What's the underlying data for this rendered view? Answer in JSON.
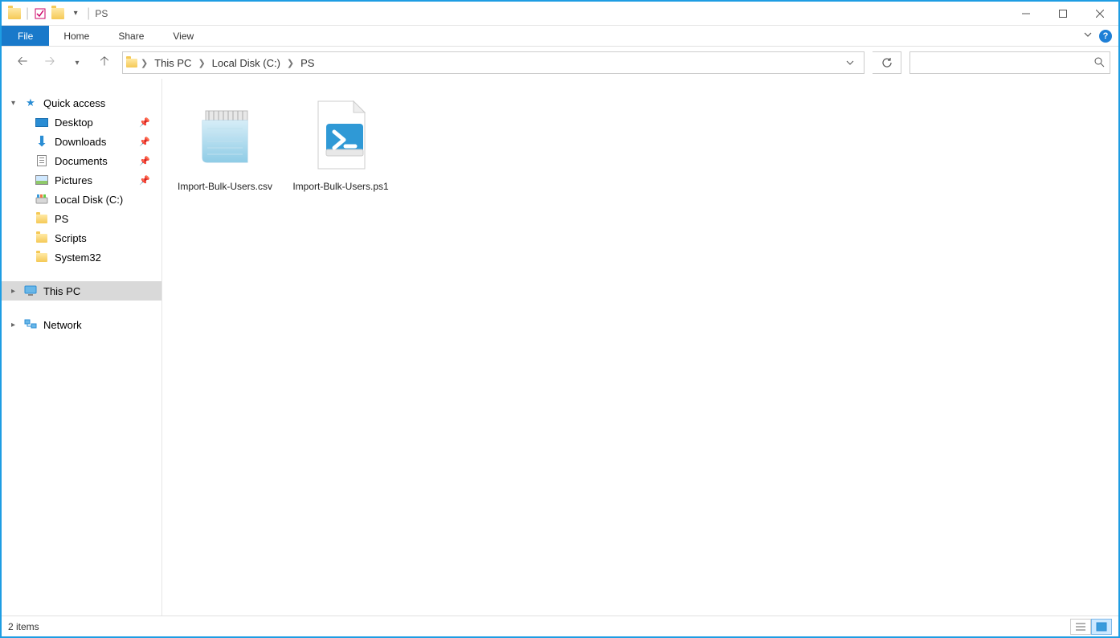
{
  "window": {
    "title": "PS"
  },
  "ribbon": {
    "file": "File",
    "tabs": [
      "Home",
      "Share",
      "View"
    ]
  },
  "breadcrumbs": [
    "This PC",
    "Local Disk (C:)",
    "PS"
  ],
  "sidebar": {
    "quick_access": {
      "label": "Quick access",
      "items": [
        {
          "label": "Desktop",
          "pinned": true,
          "icon": "desktop"
        },
        {
          "label": "Downloads",
          "pinned": true,
          "icon": "downloads"
        },
        {
          "label": "Documents",
          "pinned": true,
          "icon": "documents"
        },
        {
          "label": "Pictures",
          "pinned": true,
          "icon": "pictures"
        },
        {
          "label": "Local Disk (C:)",
          "pinned": false,
          "icon": "disk"
        },
        {
          "label": "PS",
          "pinned": false,
          "icon": "folder"
        },
        {
          "label": "Scripts",
          "pinned": false,
          "icon": "folder"
        },
        {
          "label": "System32",
          "pinned": false,
          "icon": "folder"
        }
      ]
    },
    "this_pc": {
      "label": "This PC",
      "selected": true
    },
    "network": {
      "label": "Network"
    }
  },
  "files": [
    {
      "name": "Import-Bulk-Users.csv",
      "type": "csv"
    },
    {
      "name": "Import-Bulk-Users.ps1",
      "type": "ps1"
    }
  ],
  "status": {
    "text": "2 items"
  }
}
